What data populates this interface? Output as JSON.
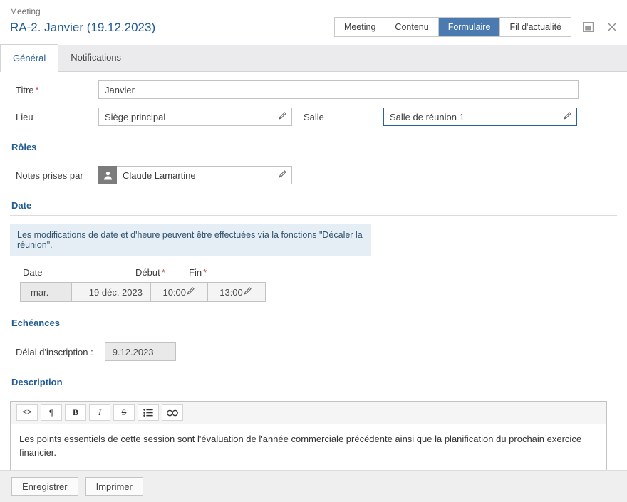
{
  "header": {
    "breadcrumb": "Meeting",
    "title": "RA-2. Janvier (19.12.2023)",
    "tabs": [
      {
        "label": "Meeting",
        "active": false
      },
      {
        "label": "Contenu",
        "active": false
      },
      {
        "label": "Formulaire",
        "active": true
      },
      {
        "label": "Fil d'actualité",
        "active": false
      }
    ],
    "layout_icon": "layout-panel-icon",
    "close_icon": "close-icon",
    "active_tab_color": "#4a7ab0",
    "title_color": "#1f5b94"
  },
  "subtabs": [
    {
      "label": "Général",
      "active": true
    },
    {
      "label": "Notifications",
      "active": false
    }
  ],
  "general": {
    "titre": {
      "label": "Titre",
      "required": "*",
      "value": "Janvier"
    },
    "lieu": {
      "label": "Lieu",
      "value": "Siège principal"
    },
    "salle": {
      "label": "Salle",
      "value": "Salle de réunion  1",
      "focused": true
    }
  },
  "roles": {
    "section_title": "Rôles",
    "notes_label": "Notes prises par",
    "notes_value": "Claude Lamartine",
    "avatar_icon": "person-icon"
  },
  "date": {
    "section_title": "Date",
    "info_banner": "Les modifications de date et d'heure peuvent être effectuées via la fonctions \"Décaler la réunion\".",
    "col_date": "Date",
    "col_debut": "Début",
    "col_fin": "Fin",
    "required": "*",
    "day": "mar.",
    "date_value": "19 déc. 2023",
    "start_time": "10:00",
    "end_time": "13:00"
  },
  "echeances": {
    "section_title": "Echéances",
    "deadline_label": "Délai d'inscription :",
    "deadline_value": "9.12.2023"
  },
  "description": {
    "section_title": "Description",
    "toolbar": [
      {
        "label": "<>",
        "name": "code-icon"
      },
      {
        "label": "¶",
        "name": "paragraph-icon"
      },
      {
        "label": "B",
        "name": "bold-icon"
      },
      {
        "label": "I",
        "name": "italic-icon"
      },
      {
        "label": "S",
        "name": "strikethrough-icon"
      },
      {
        "label": "list",
        "name": "bullet-list-icon"
      },
      {
        "label": "link",
        "name": "link-icon"
      }
    ],
    "text": "Les points essentiels de cette session sont l'évaluation de l'année commerciale précédente ainsi que la planification du prochain exercice financier."
  },
  "footer": {
    "save_label": "Enregistrer",
    "print_label": "Imprimer"
  }
}
